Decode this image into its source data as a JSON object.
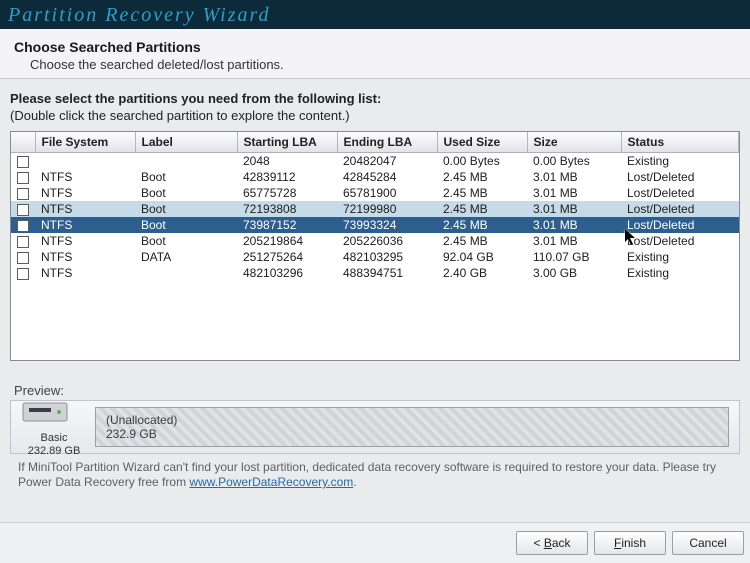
{
  "title": "Partition Recovery Wizard",
  "header": {
    "h1": "Choose Searched Partitions",
    "sub": "Choose the searched deleted/lost partitions."
  },
  "instr": {
    "line1": "Please select the partitions you need from the following list:",
    "line2": "(Double click the searched partition to explore the content.)"
  },
  "columns": {
    "fs": "File System",
    "label": "Label",
    "slba": "Starting LBA",
    "elba": "Ending LBA",
    "used": "Used Size",
    "size": "Size",
    "status": "Status"
  },
  "rows": [
    {
      "fs": "",
      "label": "",
      "slba": "2048",
      "elba": "20482047",
      "used": "0.00 Bytes",
      "size": "0.00 Bytes",
      "status": "Existing",
      "state": ""
    },
    {
      "fs": "NTFS",
      "label": "Boot",
      "slba": "42839112",
      "elba": "42845284",
      "used": "2.45 MB",
      "size": "3.01 MB",
      "status": "Lost/Deleted",
      "state": ""
    },
    {
      "fs": "NTFS",
      "label": "Boot",
      "slba": "65775728",
      "elba": "65781900",
      "used": "2.45 MB",
      "size": "3.01 MB",
      "status": "Lost/Deleted",
      "state": ""
    },
    {
      "fs": "NTFS",
      "label": "Boot",
      "slba": "72193808",
      "elba": "72199980",
      "used": "2.45 MB",
      "size": "3.01 MB",
      "status": "Lost/Deleted",
      "state": "hov"
    },
    {
      "fs": "NTFS",
      "label": "Boot",
      "slba": "73987152",
      "elba": "73993324",
      "used": "2.45 MB",
      "size": "3.01 MB",
      "status": "Lost/Deleted",
      "state": "sel"
    },
    {
      "fs": "NTFS",
      "label": "Boot",
      "slba": "205219864",
      "elba": "205226036",
      "used": "2.45 MB",
      "size": "3.01 MB",
      "status": "Lost/Deleted",
      "state": ""
    },
    {
      "fs": "NTFS",
      "label": "DATA",
      "slba": "251275264",
      "elba": "482103295",
      "used": "92.04 GB",
      "size": "110.07 GB",
      "status": "Existing",
      "state": ""
    },
    {
      "fs": "NTFS",
      "label": "",
      "slba": "482103296",
      "elba": "488394751",
      "used": "2.40 GB",
      "size": "3.00 GB",
      "status": "Existing",
      "state": ""
    }
  ],
  "preview": {
    "label": "Preview:",
    "disk_type": "Basic",
    "disk_size": "232.89 GB",
    "seg_label": "(Unallocated)",
    "seg_size": "232.9 GB"
  },
  "hint": {
    "text": "If MiniTool Partition Wizard can't find your lost partition, dedicated data recovery software is required to restore your data. Please try Power Data Recovery free from ",
    "link": "www.PowerDataRecovery.com"
  },
  "buttons": {
    "back_pre": "< ",
    "back_u": "B",
    "back_post": "ack",
    "finish_u": "F",
    "finish_post": "inish",
    "cancel": "Cancel"
  }
}
